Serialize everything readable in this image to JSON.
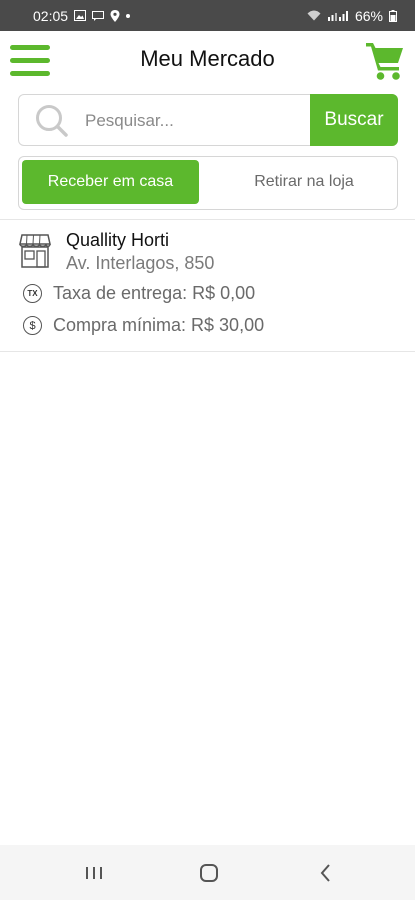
{
  "status_bar": {
    "time": "02:05",
    "battery": "66%",
    "icons": [
      "image-icon",
      "message-icon",
      "location-icon",
      "wifi-icon",
      "signal-icon",
      "battery-icon"
    ]
  },
  "header": {
    "title": "Meu Mercado",
    "menu_icon": "hamburger-menu-icon",
    "cart_icon": "shopping-cart-icon"
  },
  "search": {
    "placeholder": "Pesquisar...",
    "button_label": "Buscar"
  },
  "delivery_toggle": {
    "selected": "Receber em casa",
    "other": "Retirar na loja"
  },
  "stores": [
    {
      "name": "Quallity Horti",
      "address": "Av. Interlagos, 850",
      "fee_badge": "TX",
      "fee_label": "Taxa de entrega: R$ 0,00",
      "min_badge": "$",
      "min_label": "Compra mínima: R$ 30,00"
    }
  ],
  "nav_bar": {
    "buttons": [
      "recent-apps-icon",
      "home-icon",
      "back-icon"
    ]
  },
  "colors": {
    "accent": "#5cb82d",
    "status_bar": "#4a4a4a",
    "nav_bar": "#f5f5f5",
    "muted_text": "#7a7a7a"
  }
}
